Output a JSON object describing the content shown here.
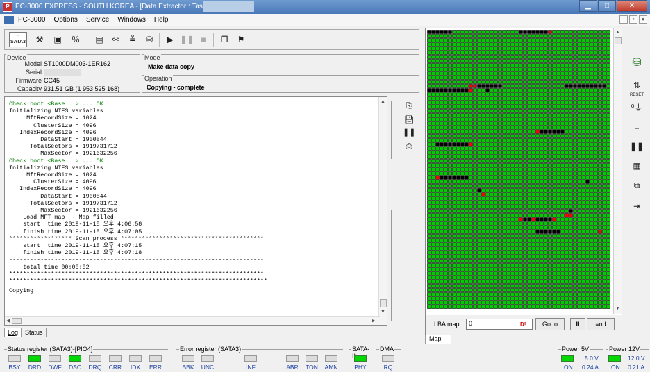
{
  "window": {
    "title": "PC-3000 EXPRESS - SOUTH KOREA - [Data Extractor : Task - \"D:",
    "minimize": "▁",
    "maximize": "□",
    "close": "✕"
  },
  "menu": {
    "items": [
      "PC-3000",
      "Options",
      "Service",
      "Windows",
      "Help"
    ],
    "mdi": [
      "_",
      "▫",
      "x"
    ]
  },
  "toolbar": {
    "sata_label": "SATA3"
  },
  "device": {
    "group_label": "Device",
    "model_label": "Model",
    "model": "ST1000DM003-1ER162",
    "serial_label": "Serial",
    "firmware_label": "Firmware",
    "firmware": "CC45",
    "capacity_label": "Capacity",
    "capacity": "931.51 GB (1 953 525 168)"
  },
  "mode": {
    "group_label": "Mode",
    "value": "Make data copy"
  },
  "operation": {
    "group_label": "Operation",
    "value": "Copying - complete"
  },
  "log": {
    "lines": [
      {
        "t": "Check boot <Base   > ... OK",
        "ok": true
      },
      {
        "t": "Initializing NTFS variables"
      },
      {
        "t": "     MftRecordSize = 1024"
      },
      {
        "t": "       ClusterSize = 4096"
      },
      {
        "t": "   IndexRecordSize = 4096"
      },
      {
        "t": "         DataStart = 1900544"
      },
      {
        "t": "      TotalSectors = 1919731712"
      },
      {
        "t": "         MaxSector = 1921632256"
      },
      {
        "t": "Check boot <Base   > ... OK",
        "ok": true
      },
      {
        "t": "Initializing NTFS variables"
      },
      {
        "t": "     MftRecordSize = 1024"
      },
      {
        "t": "       ClusterSize = 4096"
      },
      {
        "t": "   IndexRecordSize = 4096"
      },
      {
        "t": "         DataStart = 1900544"
      },
      {
        "t": "      TotalSectors = 1919731712"
      },
      {
        "t": "         MaxSector = 1921632256"
      },
      {
        "t": "    Load MFT map  - Map filled"
      },
      {
        "t": "    start  time 2019-11-15 오후 4:06:58"
      },
      {
        "t": "    finish time 2019-11-15 오후 4:07:05"
      },
      {
        "t": "****************** Scan process *****************************************"
      },
      {
        "t": "    start  time 2019-11-15 오후 4:07:15"
      },
      {
        "t": "    finish time 2019-11-15 오후 4:07:18"
      },
      {
        "t": "-------------------------------------------------------------------------"
      },
      {
        "t": "    total time 00:00:02"
      },
      {
        "t": "*************************************************************************"
      },
      {
        "t": "**************************************************************************"
      },
      {
        "t": "Copying"
      }
    ]
  },
  "tabs": {
    "log": "Log",
    "status": "Status"
  },
  "map": {
    "lba_label": "LBA map",
    "lba_value": "0",
    "red_marker": "D!",
    "goto_label": "Go to",
    "pause_label": "II",
    "end_label": "≡nd",
    "tab_label": "Map",
    "colors": {
      "ok": "#00cc00",
      "bad": "#ff0000",
      "empty": "#000000",
      "border": "#000000"
    }
  },
  "status_register": {
    "label": "Status register (SATA3)-[PIO4]",
    "flags": [
      {
        "name": "BSY",
        "on": false
      },
      {
        "name": "DRD",
        "on": true
      },
      {
        "name": "DWF",
        "on": false
      },
      {
        "name": "DSC",
        "on": true
      },
      {
        "name": "DRQ",
        "on": false
      },
      {
        "name": "CRR",
        "on": false
      },
      {
        "name": "IDX",
        "on": false
      },
      {
        "name": "ERR",
        "on": false
      }
    ]
  },
  "error_register": {
    "label": "Error register (SATA3)",
    "flags": [
      {
        "name": "BBK",
        "on": false
      },
      {
        "name": "UNC",
        "on": false
      },
      {
        "name": "INF",
        "on": false
      },
      {
        "name": "ABR",
        "on": false
      },
      {
        "name": "TON",
        "on": false
      },
      {
        "name": "AMN",
        "on": false
      }
    ]
  },
  "sata2": {
    "label": "SATA-II",
    "flag": "PHY",
    "on": true
  },
  "dma": {
    "label": "DMA",
    "flag": "RQ",
    "on": false
  },
  "power5": {
    "label": "Power 5V",
    "on_label": "ON",
    "voltage": "5.0 V",
    "current": "0.24 A"
  },
  "power12": {
    "label": "Power 12V",
    "on_label": "ON",
    "voltage": "12.0 V",
    "current": "0.21 A"
  }
}
